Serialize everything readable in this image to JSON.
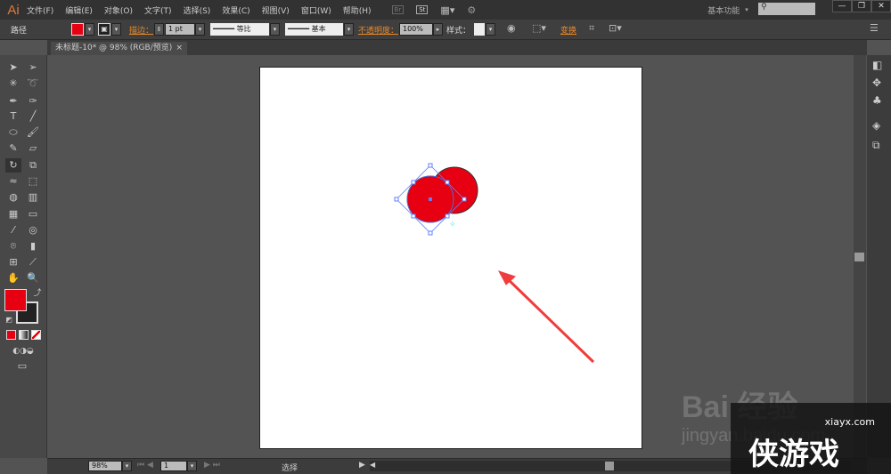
{
  "app": {
    "logo": "Ai",
    "menus": [
      "文件(F)",
      "编辑(E)",
      "对象(O)",
      "文字(T)",
      "选择(S)",
      "效果(C)",
      "视图(V)",
      "窗口(W)",
      "帮助(H)"
    ],
    "bridge": "Br",
    "stock": "St",
    "workspace": "基本功能",
    "search_placeholder": ""
  },
  "control": {
    "selection_type": "路径",
    "fill_color": "#e60012",
    "stroke_label": "描边：",
    "stroke_weight": "1 pt",
    "profile": "等比",
    "brush": "基本",
    "opacity_label": "不透明度：",
    "opacity": "100%",
    "style_label": "样式：",
    "transform_label": "变换"
  },
  "document": {
    "tab_title": "未标题-10* @ 98% (RGB/预览)",
    "close": "×"
  },
  "tools": {
    "fill_color": "#e60012",
    "stroke_color": "#222222"
  },
  "status": {
    "zoom": "98%",
    "artboard": "1",
    "mode": "选择"
  },
  "artwork": {
    "circle_color": "#e60012",
    "selection_color": "#5b7fff",
    "arrow_color": "#f03c3c"
  },
  "watermark": {
    "baidu": "Bai 经验",
    "baidu_url": "jingyan.baidu.com",
    "site": "xiayx.com",
    "site_name": "侠游戏"
  }
}
